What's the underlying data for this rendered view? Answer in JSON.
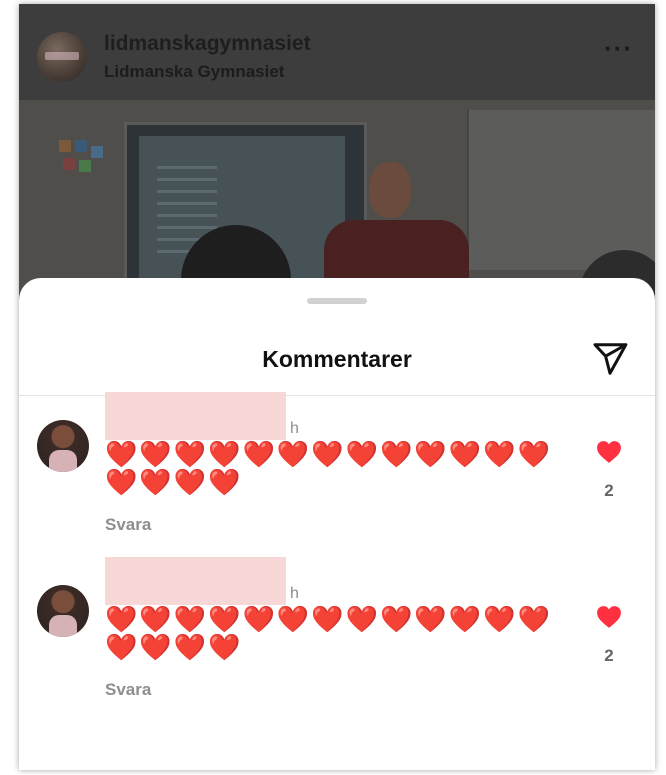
{
  "post": {
    "username": "lidmanskagymnasiet",
    "subtitle": "Lidmanska Gymnasiet",
    "more_label": "···"
  },
  "sheet": {
    "title": "Kommentarer",
    "share_icon": "paper-plane-icon"
  },
  "comments": [
    {
      "author_hidden": true,
      "meta": "h",
      "text": "❤️❤️❤️❤️❤️❤️❤️❤️❤️❤️❤️❤️❤️❤️❤️❤️❤️",
      "reply_label": "Svara",
      "likes": "2"
    },
    {
      "author_hidden": true,
      "meta": "h",
      "text": "❤️❤️❤️❤️❤️❤️❤️❤️❤️❤️❤️❤️❤️❤️❤️❤️❤️",
      "reply_label": "Svara",
      "likes": "2"
    }
  ],
  "colors": {
    "like": "#ff3040",
    "redaction": "#f8d7d7",
    "secondary_text": "#8e8e8e"
  }
}
